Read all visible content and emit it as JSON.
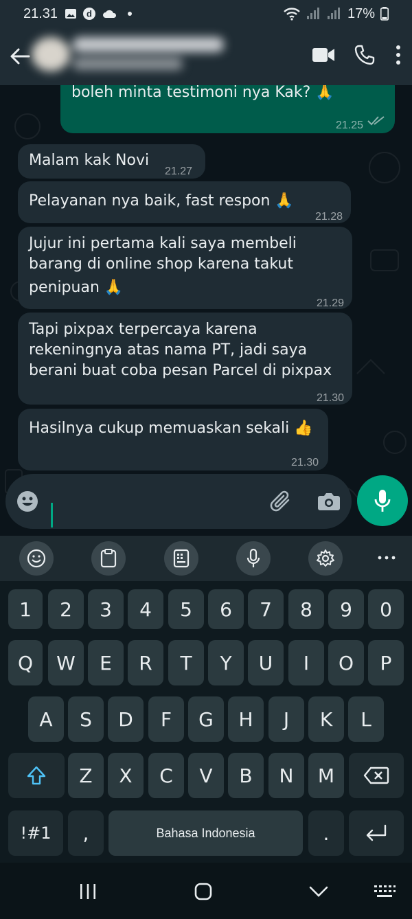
{
  "status_bar": {
    "time": "21.31",
    "battery": "17%"
  },
  "chat": {
    "messages": [
      {
        "direction": "out",
        "text": "boleh minta testimoni nya Kak? 🙏",
        "time": "21.25"
      },
      {
        "direction": "in",
        "text": "Malam kak Novi",
        "time": "21.27"
      },
      {
        "direction": "in",
        "text": "Pelayanan nya baik, fast respon 🙏",
        "time": "21.28"
      },
      {
        "direction": "in",
        "lines": [
          "Jujur ini pertama kali saya membeli",
          "barang di online shop karena takut",
          "penipuan 🙏"
        ],
        "time": "21.29"
      },
      {
        "direction": "in",
        "lines": [
          "Tapi pixpax terpercaya karena",
          "rekeningnya atas nama PT, jadi saya",
          "berani buat coba pesan Parcel di pixpax"
        ],
        "time": "21.30"
      },
      {
        "direction": "in",
        "text": "Hasilnya cukup memuaskan sekali 👍",
        "time": "21.30"
      }
    ]
  },
  "keyboard": {
    "numbers": [
      "1",
      "2",
      "3",
      "4",
      "5",
      "6",
      "7",
      "8",
      "9",
      "0"
    ],
    "row1": [
      "Q",
      "W",
      "E",
      "R",
      "T",
      "Y",
      "U",
      "I",
      "O",
      "P"
    ],
    "row2": [
      "A",
      "S",
      "D",
      "F",
      "G",
      "H",
      "J",
      "K",
      "L"
    ],
    "row3": [
      "Z",
      "X",
      "C",
      "V",
      "B",
      "N",
      "M"
    ],
    "symbols_key": "!#1",
    "comma_key": ",",
    "space_label": "Bahasa Indonesia",
    "period_key": "."
  },
  "icons": {
    "back": "arrow-left-icon",
    "video": "video-call-icon",
    "call": "phone-icon",
    "menu": "more-vert-icon",
    "emoji": "emoji-icon",
    "attach": "paperclip-icon",
    "camera": "camera-icon",
    "mic": "mic-icon"
  },
  "colors": {
    "accent": "#00a884",
    "outgoing_bubble": "#005c4b",
    "incoming_bubble": "#1f2c34",
    "background": "#0b141a"
  }
}
